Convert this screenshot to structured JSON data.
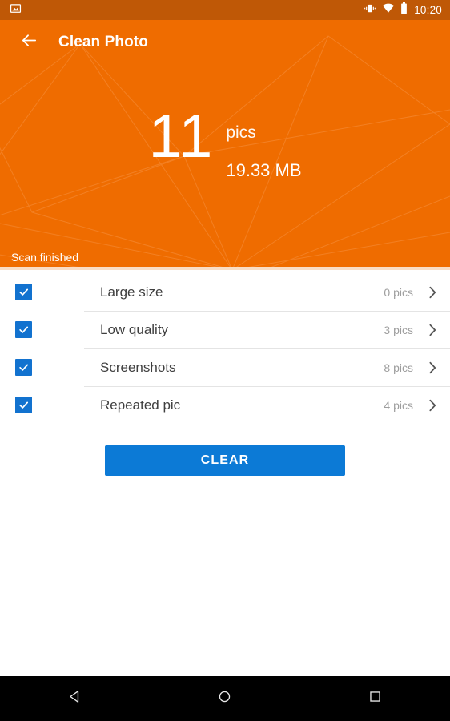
{
  "status_bar": {
    "app_icon": "image-icon",
    "icons": [
      "vibrate-icon",
      "wifi-icon",
      "battery-icon"
    ],
    "clock": "10:20",
    "background": "#bf5806"
  },
  "app_bar": {
    "back_icon": "arrow-back-icon",
    "title": "Clean Photo"
  },
  "header": {
    "background": "#ef6c00",
    "summary": {
      "count": "11",
      "unit": "pics",
      "size": "19.33 MB"
    },
    "scan_status": "Scan finished",
    "progress_percent": 100,
    "progress_color": "#f9ddc6"
  },
  "list": {
    "rows": [
      {
        "label": "Large size",
        "count": "0 pics",
        "checked": true,
        "chevron": "chevron-right-icon"
      },
      {
        "label": "Low quality",
        "count": "3 pics",
        "checked": true,
        "chevron": "chevron-right-icon"
      },
      {
        "label": "Screenshots",
        "count": "8 pics",
        "checked": true,
        "chevron": "chevron-right-icon"
      },
      {
        "label": "Repeated pic",
        "count": "4 pics",
        "checked": true,
        "chevron": "chevron-right-icon"
      }
    ]
  },
  "actions": {
    "clear_label": "CLEAR",
    "clear_color": "#0c7ad6"
  },
  "nav_bar": {
    "back": "nav-back-icon",
    "home": "nav-home-icon",
    "recents": "nav-recents-icon",
    "background": "#000000"
  }
}
